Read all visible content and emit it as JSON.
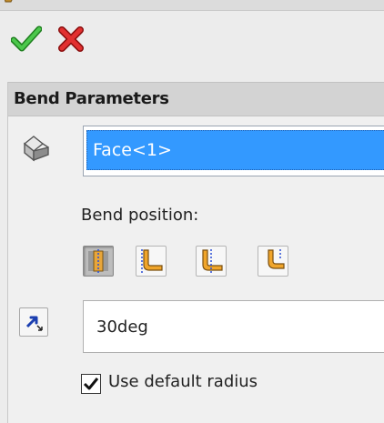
{
  "toolbar": {
    "ok_icon": "check-icon",
    "cancel_icon": "close-icon",
    "ok_color": "#2aa12a",
    "cancel_color": "#d61e1e"
  },
  "bend_parameters": {
    "title": "Bend Parameters",
    "face_selection": {
      "icon": "face-select-icon",
      "items": [
        "Face<1>"
      ],
      "selected_color": "#3399ff"
    },
    "bend_position": {
      "label": "Bend position:",
      "options": [
        {
          "icon": "bend-centerline-icon",
          "active": true
        },
        {
          "icon": "material-inside-icon",
          "active": false
        },
        {
          "icon": "material-outside-icon",
          "active": false
        },
        {
          "icon": "bend-outside-icon",
          "active": false
        }
      ]
    },
    "angle": {
      "icon": "reverse-direction-icon",
      "value": "30deg"
    },
    "default_radius": {
      "label": "Use default radius",
      "checked": true
    }
  }
}
